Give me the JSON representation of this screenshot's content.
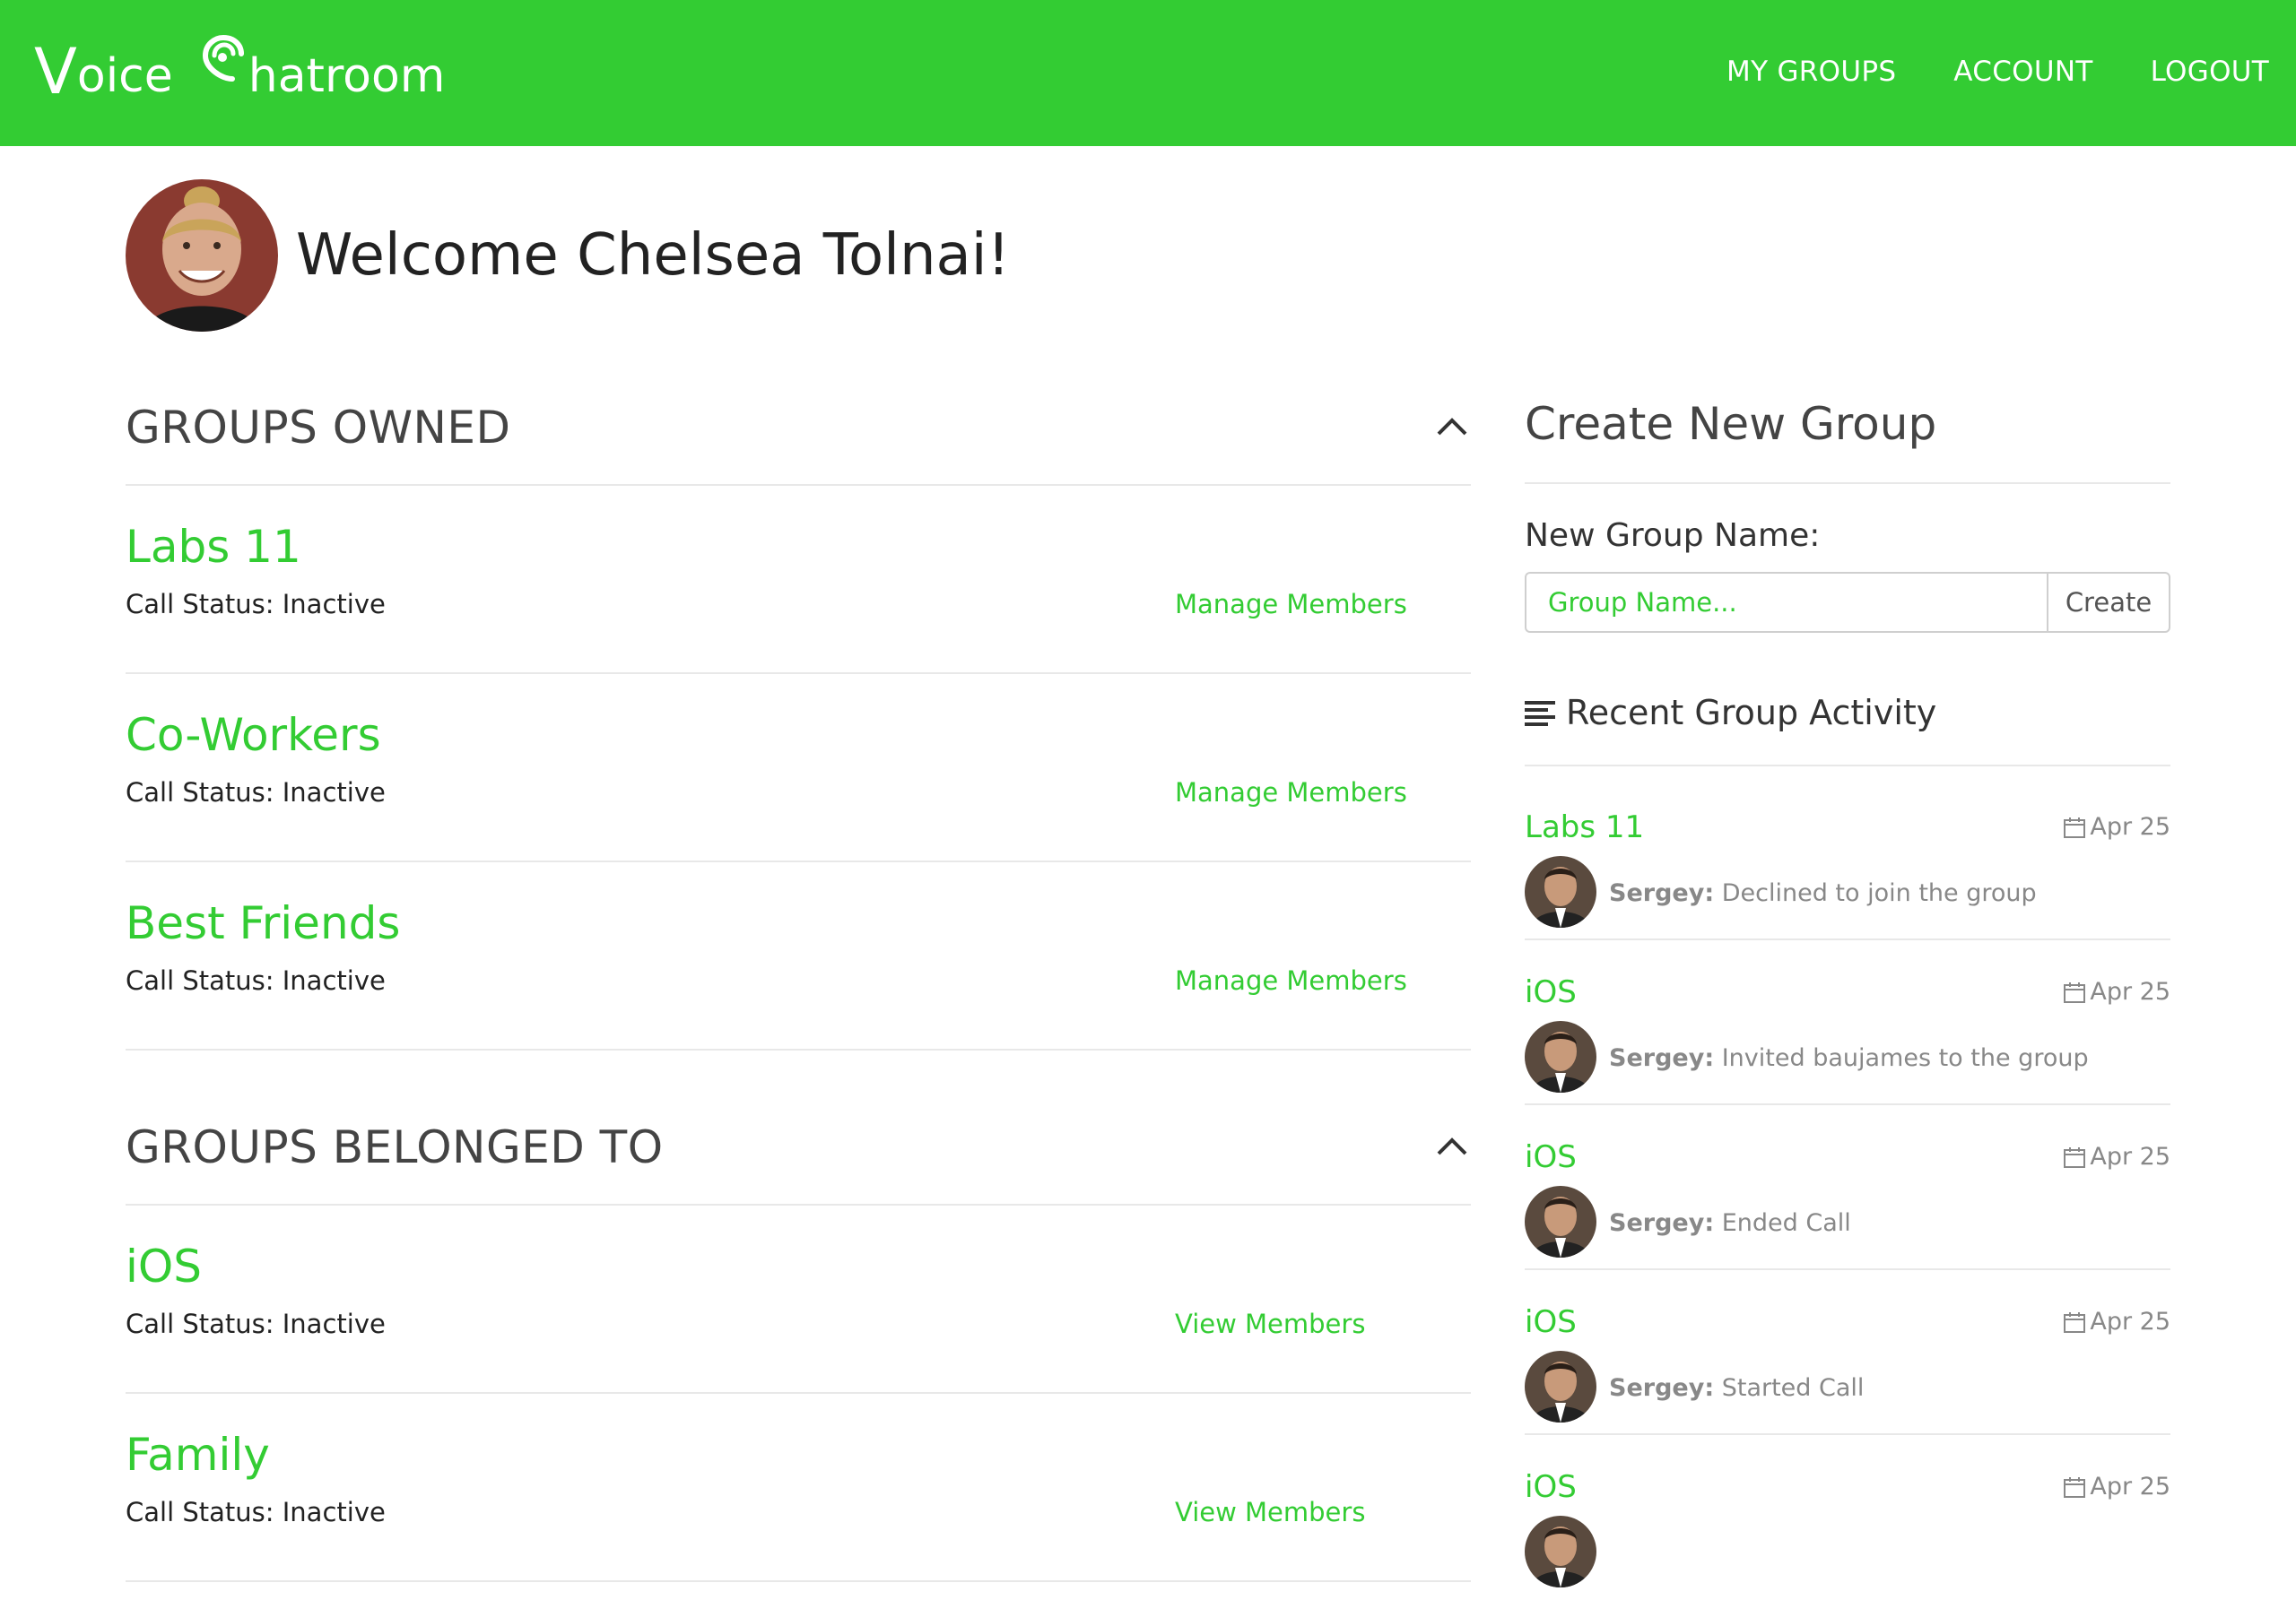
{
  "navbar": {
    "brand": {
      "part1_big": "V",
      "part1_rest": "oice",
      "part2_rest": "hatroom"
    },
    "links": [
      "MY GROUPS",
      "ACCOUNT",
      "LOGOUT"
    ],
    "color": "#33cc33"
  },
  "welcome": {
    "title": "Welcome Chelsea Tolnai!"
  },
  "groups_owned": {
    "title": "GROUPS OWNED",
    "items": [
      {
        "name": "Labs 11",
        "status": "Call Status: Inactive",
        "action": "Manage Members"
      },
      {
        "name": "Co-Workers",
        "status": "Call Status: Inactive",
        "action": "Manage Members"
      },
      {
        "name": "Best Friends",
        "status": "Call Status: Inactive",
        "action": "Manage Members"
      }
    ]
  },
  "groups_belonged": {
    "title": "GROUPS BELONGED TO",
    "items": [
      {
        "name": "iOS",
        "status": "Call Status: Inactive",
        "action": "View Members"
      },
      {
        "name": "Family",
        "status": "Call Status: Inactive",
        "action": "View Members"
      }
    ]
  },
  "create_group": {
    "title": "Create New Group",
    "label": "New Group Name:",
    "placeholder": "Group Name...",
    "button": "Create"
  },
  "activity": {
    "title": "Recent Group Activity",
    "items": [
      {
        "group": "Labs 11",
        "date": "Apr 25",
        "user": "Sergey:",
        "text": "Declined to join the group"
      },
      {
        "group": "iOS",
        "date": "Apr 25",
        "user": "Sergey:",
        "text": "Invited baujames to the group"
      },
      {
        "group": "iOS",
        "date": "Apr 25",
        "user": "Sergey:",
        "text": "Ended Call"
      },
      {
        "group": "iOS",
        "date": "Apr 25",
        "user": "Sergey:",
        "text": "Started Call"
      },
      {
        "group": "iOS",
        "date": "Apr 25",
        "user": "",
        "text": ""
      }
    ]
  }
}
